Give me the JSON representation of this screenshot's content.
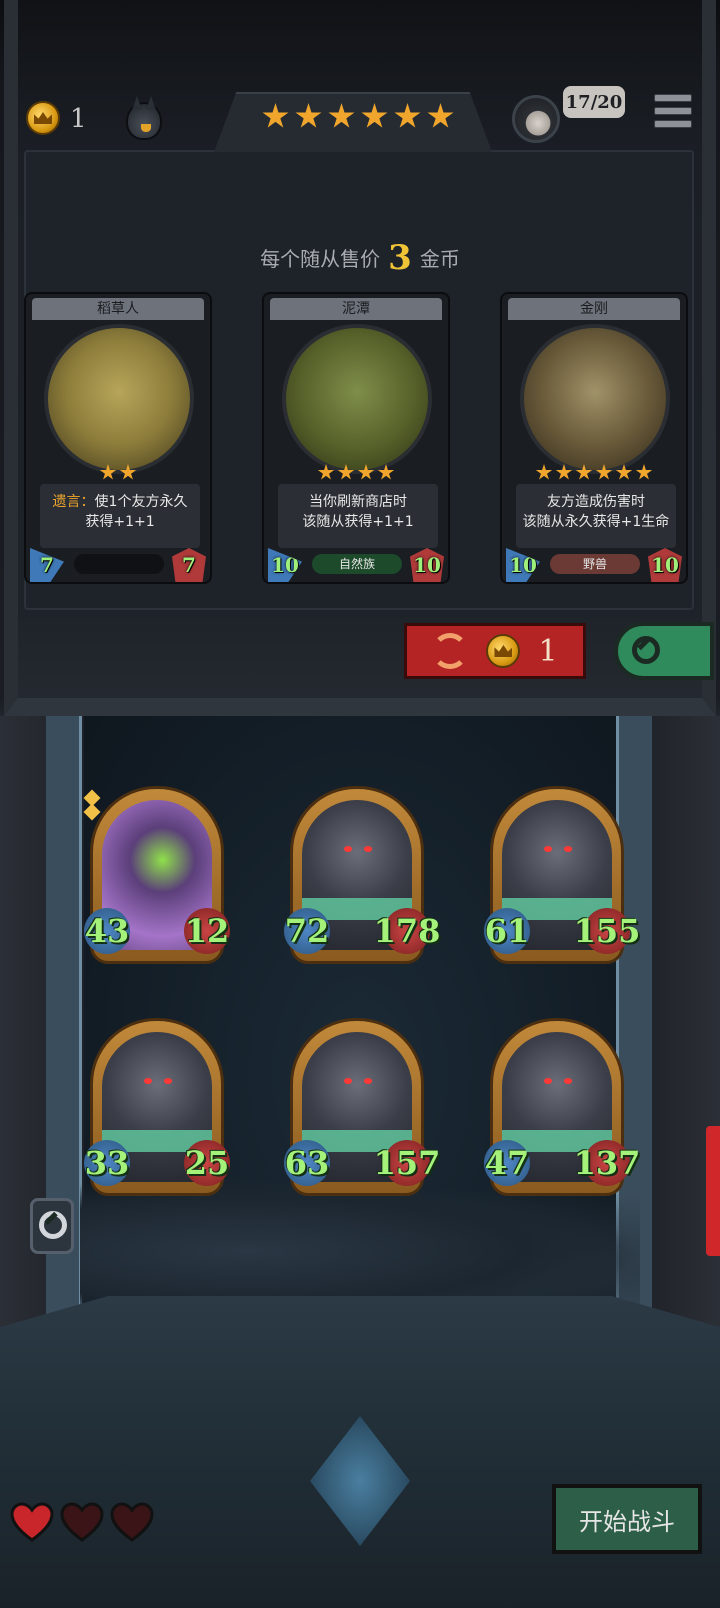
{
  "hud": {
    "gold": "1",
    "tavern_stars": 6,
    "capacity": "17/20"
  },
  "shop": {
    "price_prefix": "每个随从售价",
    "price_value": "3",
    "price_suffix": "金币",
    "cards": [
      {
        "name": "稻草人",
        "stars": 2,
        "keyword": "遗言：",
        "desc_line1": "使1个友方永久",
        "desc_line2": "获得+1+1",
        "attack": "7",
        "health": "7",
        "tribe": ""
      },
      {
        "name": "泥潭",
        "stars": 4,
        "keyword": "",
        "desc_line1": "当你刷新商店时",
        "desc_line2": "该随从获得+1+1",
        "attack": "10",
        "health": "10",
        "tribe": "自然族"
      },
      {
        "name": "金刚",
        "stars": 6,
        "keyword": "",
        "desc_line1": "友方造成伤害时",
        "desc_line2": "该随从永久获得+1生命",
        "attack": "10",
        "health": "10",
        "tribe": "野兽"
      }
    ],
    "refresh_cost": "1"
  },
  "board": {
    "minions": [
      {
        "kind": "wolf",
        "attack": "43",
        "health": "12",
        "golden": true
      },
      {
        "kind": "beast",
        "attack": "72",
        "health": "178",
        "golden": false
      },
      {
        "kind": "beast",
        "attack": "61",
        "health": "155",
        "golden": false
      },
      {
        "kind": "beast",
        "attack": "33",
        "health": "25",
        "golden": false
      },
      {
        "kind": "beast",
        "attack": "63",
        "health": "157",
        "golden": false
      },
      {
        "kind": "beast",
        "attack": "47",
        "health": "137",
        "golden": false
      }
    ]
  },
  "lives": {
    "filled": 1,
    "total": 3
  },
  "actions": {
    "start_battle": "开始战斗"
  },
  "colors": {
    "gold_text": "#f0c337",
    "stat_text": "#a4f27a",
    "refresh_red": "#b52424",
    "start_green": "#2d5e47",
    "star": "#f0a62c"
  },
  "icons": [
    "coin-icon",
    "pet-icon",
    "star-icon",
    "avatar-icon",
    "menu-icon",
    "refresh-icon",
    "search-icon",
    "heart-icon"
  ]
}
